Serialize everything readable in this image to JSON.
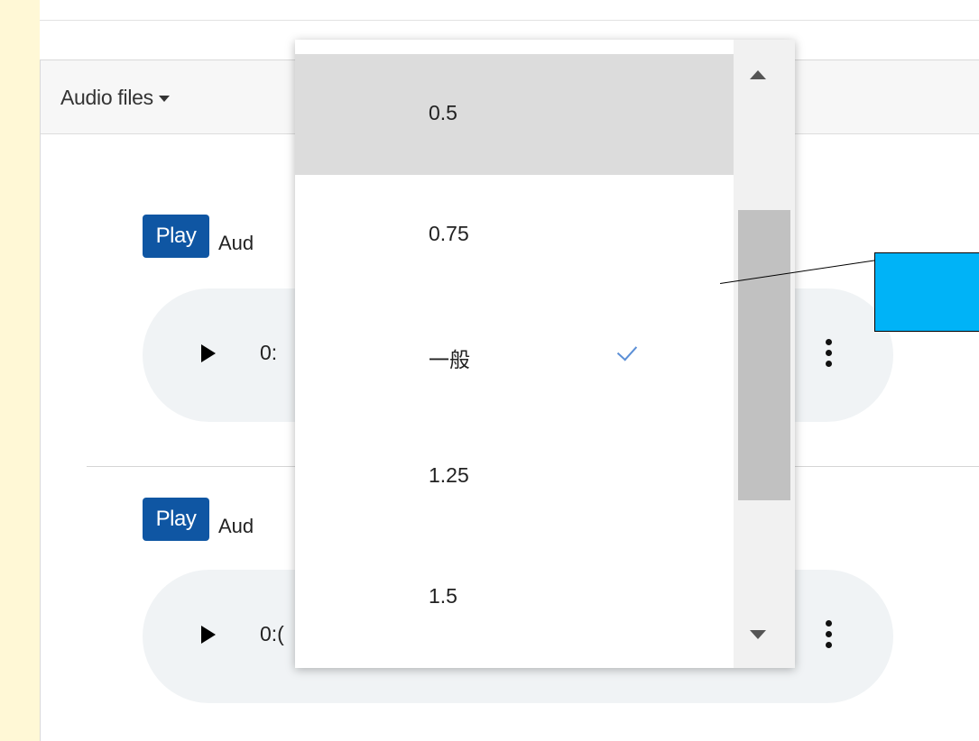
{
  "header": {
    "audio_files_label": "Audio files"
  },
  "tracks": [
    {
      "play_label": "Play",
      "name": "Aud",
      "time": "0:"
    },
    {
      "play_label": "Play",
      "name": "Aud",
      "time": "0:("
    }
  ],
  "speed_menu": {
    "items": [
      {
        "label": "0.5",
        "highlighted": true,
        "selected": false
      },
      {
        "label": "0.75",
        "highlighted": false,
        "selected": false
      },
      {
        "label": "一般",
        "highlighted": false,
        "selected": true
      },
      {
        "label": "1.25",
        "highlighted": false,
        "selected": false
      },
      {
        "label": "1.5",
        "highlighted": false,
        "selected": false
      }
    ]
  },
  "colors": {
    "play_button": "#0f56a3",
    "highlight": "#dcdcdc",
    "check": "#5b8fd6",
    "callout": "#00b3f7",
    "page_background": "#fff8d6"
  },
  "icons": {
    "caret": "caret-down-icon",
    "play": "play-icon",
    "more": "more-vertical-icon",
    "check": "checkmark-icon",
    "scroll_up": "scroll-up-arrow-icon",
    "scroll_down": "scroll-down-arrow-icon"
  }
}
